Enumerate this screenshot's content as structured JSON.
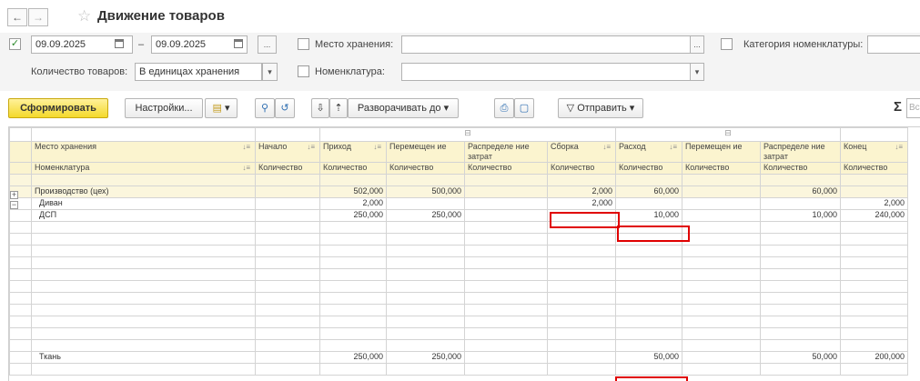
{
  "window": {
    "title": "Движение товаров",
    "back_icon": "←",
    "forward_icon": "→",
    "favorite_icon": "☆"
  },
  "filters": {
    "period_enabled": true,
    "date_from": "09.09.2025",
    "date_separator": "–",
    "date_to": "09.09.2025",
    "period_button": "...",
    "storage_label": "Место хранения:",
    "storage_value": "",
    "storage_button": "...",
    "category_label": "Категория номенклатуры:",
    "category_value": "",
    "qty_label": "Количество товаров:",
    "qty_value": "В единицах хранения",
    "nomenclature_label": "Номенклатура:",
    "nomenclature_value": ""
  },
  "toolbar": {
    "generate": "Сформировать",
    "settings": "Настройки...",
    "expand_to": "Разворачивать до",
    "send": "Отправить",
    "sum_icon": "Σ",
    "search_placeholder": "Вс"
  },
  "table": {
    "headers": {
      "storage": "Место хранения",
      "nomenclature": "Номенклатура",
      "start": "Начало",
      "income": "Приход",
      "moved_in": "Перемещен ие",
      "dist_in": "Распределе ние затрат",
      "assembly": "Сборка",
      "expense": "Расход",
      "moved_out": "Перемещен ие",
      "dist_out": "Распределе ние затрат",
      "end": "Конец",
      "qty": "Количество"
    },
    "rows": [
      {
        "name": "Производство (цех)",
        "start": "",
        "income": "502,000",
        "moved_in": "500,000",
        "dist_in": "",
        "assembly": "2,000",
        "expense": "60,000",
        "moved_out": "",
        "dist_out": "60,000",
        "end": ""
      },
      {
        "name": "Диван",
        "start": "",
        "income": "2,000",
        "moved_in": "",
        "dist_in": "",
        "assembly": "2,000",
        "expense": "",
        "moved_out": "",
        "dist_out": "",
        "end": "2,000"
      },
      {
        "name": "ДСП",
        "start": "",
        "income": "250,000",
        "moved_in": "250,000",
        "dist_in": "",
        "assembly": "",
        "expense": "10,000",
        "moved_out": "",
        "dist_out": "10,000",
        "end": "240,000"
      },
      {
        "name": "Ткань",
        "start": "",
        "income": "250,000",
        "moved_in": "250,000",
        "dist_in": "",
        "assembly": "",
        "expense": "50,000",
        "moved_out": "",
        "dist_out": "50,000",
        "end": "200,000"
      }
    ]
  },
  "colors": {
    "header_bg": "#fbf4cf",
    "primary_button": "#f4d92b",
    "highlight": "#e00000"
  }
}
